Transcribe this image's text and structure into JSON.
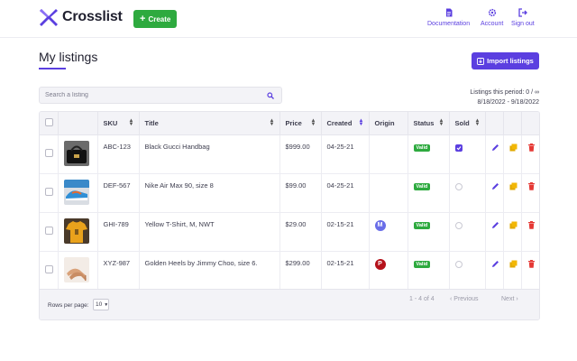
{
  "app": {
    "name": "Crosslist",
    "create_label": "Create"
  },
  "nav": [
    {
      "label": "Documentation",
      "icon": "document-icon"
    },
    {
      "label": "Account",
      "icon": "gear-icon"
    },
    {
      "label": "Sign out",
      "icon": "sign-out-icon"
    }
  ],
  "page": {
    "title": "My listings",
    "import_label": "Import listings"
  },
  "search": {
    "placeholder": "Search a listing"
  },
  "period": {
    "label": "Listings this period: 0 / ∞",
    "range": "8/18/2022 - 9/18/2022"
  },
  "table": {
    "columns": [
      "SKU",
      "Title",
      "Price",
      "Created",
      "Origin",
      "Status",
      "Sold"
    ],
    "rows": [
      {
        "sku": "ABC-123",
        "title": "Black Gucci Handbag",
        "price": "$999.00",
        "created": "04-25-21",
        "origin": "",
        "status": "Valid",
        "sold": true,
        "thumb": "handbag"
      },
      {
        "sku": "DEF-567",
        "title": "Nike Air Max 90, size 8",
        "price": "$99.00",
        "created": "04-25-21",
        "origin": "",
        "status": "Valid",
        "sold": false,
        "thumb": "sneaker"
      },
      {
        "sku": "GHI-789",
        "title": "Yellow T-Shirt, M, NWT",
        "price": "$29.00",
        "created": "02-15-21",
        "origin": "M",
        "status": "Valid",
        "sold": false,
        "thumb": "tshirt"
      },
      {
        "sku": "XYZ-987",
        "title": "Golden Heels by Jimmy Choo, size 6.",
        "price": "$299.00",
        "created": "02-15-21",
        "origin": "P",
        "status": "Valid",
        "sold": false,
        "thumb": "heels"
      }
    ]
  },
  "footer": {
    "rows_per_page_label": "Rows per page:",
    "rows_per_page": "10",
    "range": "1 - 4 of 4",
    "prev": "Previous",
    "next": "Next"
  },
  "colors": {
    "accent": "#5b3fe0",
    "valid": "#2eaa3f",
    "edit": "#5b3fe0",
    "duplicate": "#f2b705",
    "delete": "#e53935",
    "origin_m": "#6a6ee8",
    "origin_p": "#b5121b"
  }
}
